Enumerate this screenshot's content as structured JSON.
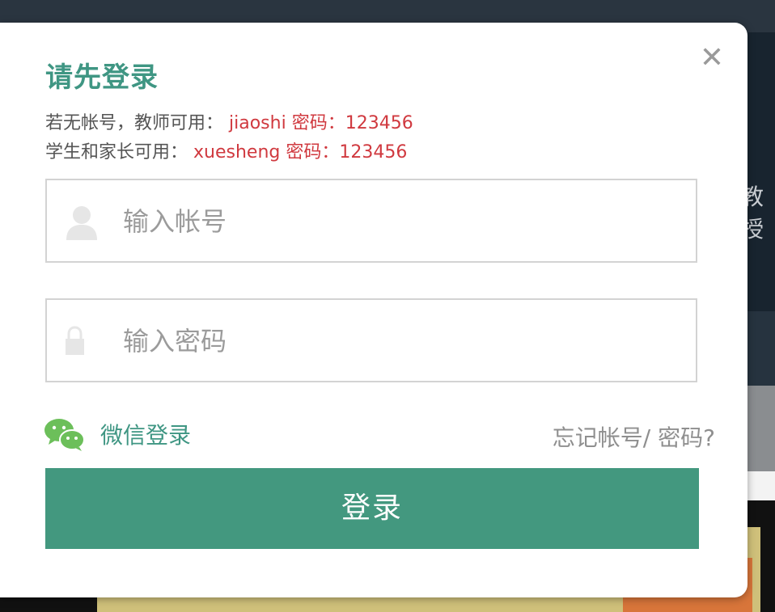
{
  "background": {
    "side_text": "教授"
  },
  "modal": {
    "title": "请先登录",
    "close_icon": "close-icon",
    "hint_line1": {
      "prefix": "若无帐号，教师可用：",
      "account": "jiaoshi",
      "password_label": "密码：123456"
    },
    "hint_line2": {
      "prefix": "学生和家长可用：",
      "account": "xuesheng",
      "password_label": "密码：123456"
    },
    "username": {
      "placeholder": "输入帐号",
      "value": "",
      "icon": "user-icon"
    },
    "password": {
      "placeholder": "输入密码",
      "value": "",
      "icon": "lock-icon"
    },
    "wechat_login": {
      "label": "微信登录",
      "icon": "wechat-icon"
    },
    "forgot_label": "忘记帐号/ 密码?",
    "login_label": "登录"
  },
  "colors": {
    "accent": "#43987f",
    "hint_red": "#d0393f",
    "title_green": "#3f9683"
  }
}
